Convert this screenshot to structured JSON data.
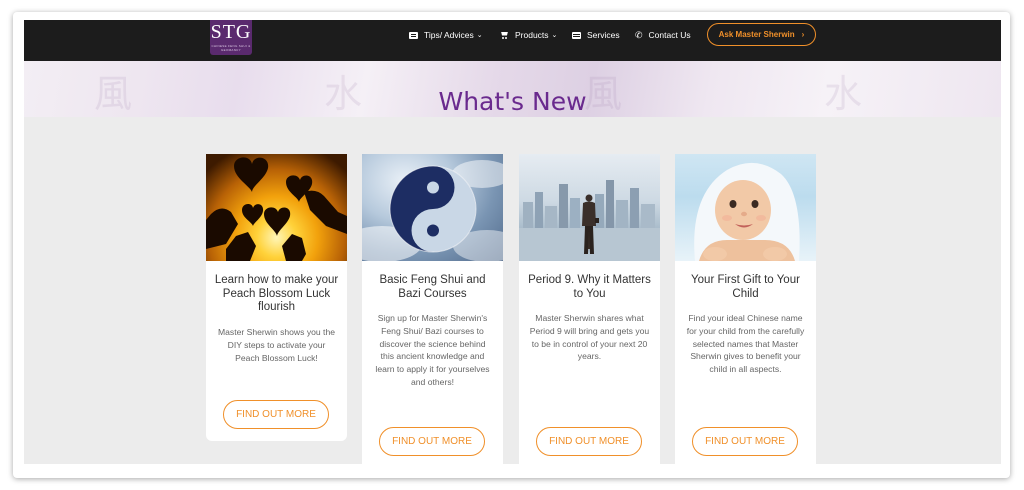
{
  "logo": {
    "text": "STG",
    "subtext": "CHINESE FENG SHUI & GEOMANCY"
  },
  "nav": {
    "items": [
      {
        "label": "Tips/ Advices",
        "icon": "advice-icon",
        "has_dropdown": true
      },
      {
        "label": "Products",
        "icon": "cart-icon",
        "has_dropdown": true
      },
      {
        "label": "Services",
        "icon": "services-icon",
        "has_dropdown": false
      },
      {
        "label": "Contact Us",
        "icon": "phone-icon",
        "has_dropdown": false
      }
    ],
    "cta_label": "Ask Master Sherwin",
    "chevron": "⌄",
    "cta_arrow": "›",
    "phone_glyph": "✆"
  },
  "page_title": "What's New",
  "cards": [
    {
      "title": "Learn how to make your Peach Blossom Luck flourish",
      "description": "Master Sherwin shows you the DIY steps to activate your Peach Blossom Luck!",
      "button_label": "FIND OUT MORE",
      "image": "hearts-sunset-image"
    },
    {
      "title": "Basic Feng Shui and Bazi Courses",
      "description": "Sign up for Master Sherwin's Feng Shui/ Bazi courses to discover the science behind this ancient knowledge and learn to apply it for yourselves and others!",
      "button_label": "FIND OUT MORE",
      "image": "yin-yang-sky-image"
    },
    {
      "title": "Period 9. Why it Matters to You",
      "description": "Master Sherwin shares what Period 9 will bring and gets you to be in control of your next 20 years.",
      "button_label": "FIND OUT MORE",
      "image": "businessman-city-image"
    },
    {
      "title": "Your First Gift to Your Child",
      "description": "Find your ideal Chinese name for your child from the carefully selected names that Master Sherwin gives to benefit your child in all aspects.",
      "button_label": "FIND OUT MORE",
      "image": "baby-towel-image"
    }
  ],
  "colors": {
    "navbar": "#1c1c1c",
    "accent": "#f0902a",
    "title": "#6a2a8e",
    "logo": "#5a2a6e",
    "page_bg": "#ececec"
  }
}
